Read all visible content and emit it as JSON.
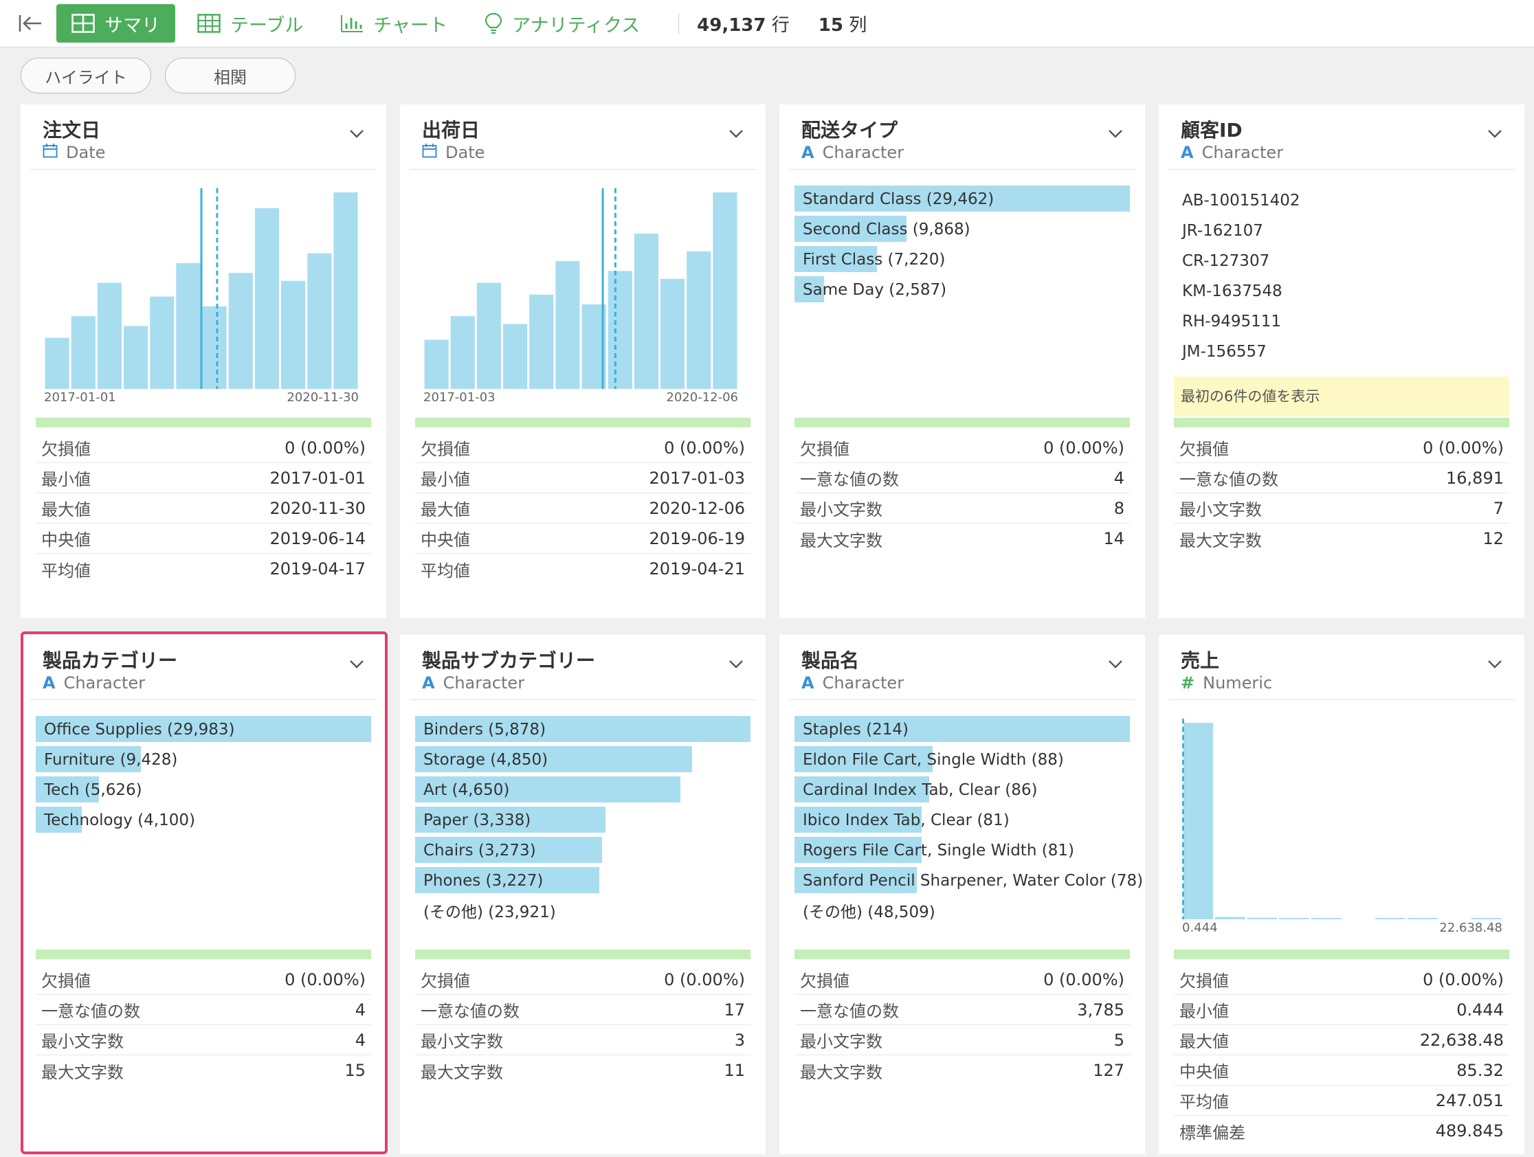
{
  "toolbar": {
    "tabs": [
      {
        "label": "サマリ",
        "icon": "grid-icon",
        "active": true
      },
      {
        "label": "テーブル",
        "icon": "table-icon"
      },
      {
        "label": "チャート",
        "icon": "bar-chart-icon"
      },
      {
        "label": "アナリティクス",
        "icon": "lightbulb-icon"
      }
    ],
    "rows_value": "49,137",
    "rows_unit": "行",
    "cols_value": "15",
    "cols_unit": "列"
  },
  "subtabs": [
    "ハイライト",
    "相関"
  ],
  "cards": [
    {
      "title": "注文日",
      "type_label": "Date",
      "type_icon": "calendar-icon",
      "hist": {
        "values": [
          0.26,
          0.37,
          0.54,
          0.32,
          0.47,
          0.64,
          0.42,
          0.59,
          0.92,
          0.55,
          0.69,
          1.0
        ],
        "line_solid": 0.5,
        "line_dashed": 0.55,
        "min_label": "2017-01-01",
        "max_label": "2020-11-30"
      },
      "stats": [
        [
          "欠損値",
          "0 (0.00%)"
        ],
        [
          "最小値",
          "2017-01-01"
        ],
        [
          "最大値",
          "2020-11-30"
        ],
        [
          "中央値",
          "2019-06-14"
        ],
        [
          "平均値",
          "2019-04-17"
        ]
      ]
    },
    {
      "title": "出荷日",
      "type_label": "Date",
      "type_icon": "calendar-icon",
      "hist": {
        "values": [
          0.25,
          0.37,
          0.54,
          0.33,
          0.48,
          0.65,
          0.43,
          0.6,
          0.79,
          0.56,
          0.7,
          1.0
        ],
        "line_solid": 0.57,
        "line_dashed": 0.61,
        "min_label": "2017-01-03",
        "max_label": "2020-12-06"
      },
      "stats": [
        [
          "欠損値",
          "0 (0.00%)"
        ],
        [
          "最小値",
          "2017-01-03"
        ],
        [
          "最大値",
          "2020-12-06"
        ],
        [
          "中央値",
          "2019-06-19"
        ],
        [
          "平均値",
          "2019-04-21"
        ]
      ]
    },
    {
      "title": "配送タイプ",
      "type_label": "Character",
      "type_icon": "character-icon",
      "bars": [
        [
          "Standard Class (29,462)",
          1.0
        ],
        [
          "Second Class (9,868)",
          0.335
        ],
        [
          "First Class (7,220)",
          0.245
        ],
        [
          "Same Day (2,587)",
          0.088
        ]
      ],
      "stats": [
        [
          "欠損値",
          "0 (0.00%)"
        ],
        [
          "一意な値の数",
          "4"
        ],
        [
          "最小文字数",
          "8"
        ],
        [
          "最大文字数",
          "14"
        ]
      ]
    },
    {
      "title": "顧客ID",
      "type_label": "Character",
      "type_icon": "character-icon",
      "list": [
        "AB-100151402",
        "JR-162107",
        "CR-127307",
        "KM-1637548",
        "RH-9495111",
        "JM-156557"
      ],
      "note": "最初の6件の値を表示",
      "stats": [
        [
          "欠損値",
          "0 (0.00%)"
        ],
        [
          "一意な値の数",
          "16,891"
        ],
        [
          "最小文字数",
          "7"
        ],
        [
          "最大文字数",
          "12"
        ]
      ]
    },
    {
      "title": "製品カテゴリー",
      "type_label": "Character",
      "type_icon": "character-icon",
      "bars": [
        [
          "Office Supplies (29,983)",
          1.0
        ],
        [
          "Furniture (9,428)",
          0.314
        ],
        [
          "Tech (5,626)",
          0.188
        ],
        [
          "Technology (4,100)",
          0.137
        ]
      ],
      "stats": [
        [
          "欠損値",
          "0 (0.00%)"
        ],
        [
          "一意な値の数",
          "4"
        ],
        [
          "最小文字数",
          "4"
        ],
        [
          "最大文字数",
          "15"
        ]
      ]
    },
    {
      "title": "製品サブカテゴリー",
      "type_label": "Character",
      "type_icon": "character-icon",
      "bars": [
        [
          "Binders (5,878)",
          1.0
        ],
        [
          "Storage (4,850)",
          0.825
        ],
        [
          "Art (4,650)",
          0.791
        ],
        [
          "Paper (3,338)",
          0.568
        ],
        [
          "Chairs (3,273)",
          0.557
        ],
        [
          "Phones (3,227)",
          0.549
        ]
      ],
      "other": "(その他) (23,921)",
      "stats": [
        [
          "欠損値",
          "0 (0.00%)"
        ],
        [
          "一意な値の数",
          "17"
        ],
        [
          "最小文字数",
          "3"
        ],
        [
          "最大文字数",
          "11"
        ]
      ]
    },
    {
      "title": "製品名",
      "type_label": "Character",
      "type_icon": "character-icon",
      "bars": [
        [
          "Staples (214)",
          1.0
        ],
        [
          "Eldon File Cart, Single Width (88)",
          0.411
        ],
        [
          "Cardinal Index Tab, Clear (86)",
          0.402
        ],
        [
          "Ibico Index Tab, Clear (81)",
          0.379
        ],
        [
          "Rogers File Cart, Single Width (81)",
          0.379
        ],
        [
          "Sanford Pencil Sharpener, Water Color (78)",
          0.364
        ]
      ],
      "other": "(その他) (48,509)",
      "stats": [
        [
          "欠損値",
          "0 (0.00%)"
        ],
        [
          "一意な値の数",
          "3,785"
        ],
        [
          "最小文字数",
          "5"
        ],
        [
          "最大文字数",
          "127"
        ]
      ]
    },
    {
      "title": "売上",
      "type_label": "Numeric",
      "type_icon": "hash-icon",
      "hist": {
        "values": [
          1.0,
          0.012,
          0.008,
          0.006,
          0.005,
          0.0,
          0.004,
          0.003,
          0.0,
          0.004
        ],
        "line_solid": null,
        "line_dashed": 0.003,
        "min_label": "0.444",
        "max_label": "22,638.48"
      },
      "stats": [
        [
          "欠損値",
          "0 (0.00%)"
        ],
        [
          "最小値",
          "0.444"
        ],
        [
          "最大値",
          "22,638.48"
        ],
        [
          "中央値",
          "85.32"
        ],
        [
          "平均値",
          "247.051"
        ],
        [
          "標準偏差",
          "489.845"
        ]
      ]
    }
  ],
  "colors": {
    "accent": "#4cae5b",
    "bar": "#a8ddf0",
    "highlight": "#e33e6c",
    "note_bg": "#fdf8c4"
  }
}
